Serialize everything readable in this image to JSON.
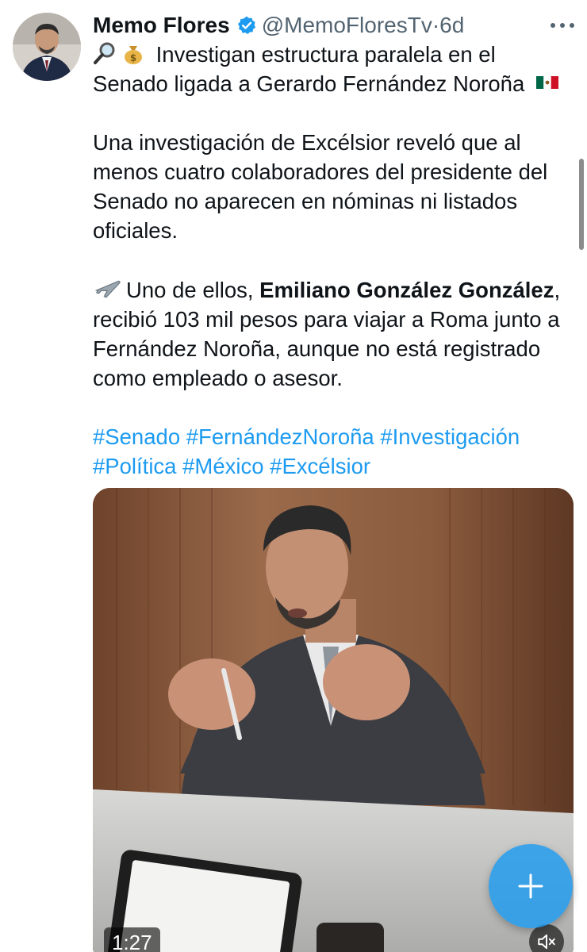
{
  "author": {
    "name": "Memo Flores",
    "handle": "@MemoFloresTv",
    "separator": "·",
    "time": "6d",
    "avatar_icon": "profile-photo"
  },
  "tweet": {
    "line1_emojis": [
      "magnifier-emoji",
      "money-bag-emoji"
    ],
    "headline": "Investigan estructura paralela en el Senado ligada a Gerardo Fernández Noroña",
    "headline_flag": "mexico-flag-emoji",
    "paragraph1": "Una investigación de Excélsior reveló que al menos cuatro colaboradores del presidente del Senado no aparecen en nóminas ni listados oficiales.",
    "paragraph2_emoji": "airplane-emoji",
    "paragraph2_pre": "Uno de ellos, ",
    "paragraph2_bold": "Emiliano González González",
    "paragraph2_post": ", recibió 103 mil pesos para viajar a Roma junto a Fernández Noroña, aunque no está registrado como empleado o asesor.",
    "hashtags": [
      "#Senado",
      "#FernándezNoroña",
      "#Investigación",
      "#Política",
      "#México",
      "#Excélsior"
    ]
  },
  "video": {
    "duration": "1:27",
    "mute_icon": "speaker-muted-icon"
  },
  "compose_button": {
    "icon": "plus-icon"
  },
  "colors": {
    "link": "#1d9bf0",
    "text": "#0f1419",
    "secondary": "#536471",
    "verified": "#1d9bf0"
  }
}
